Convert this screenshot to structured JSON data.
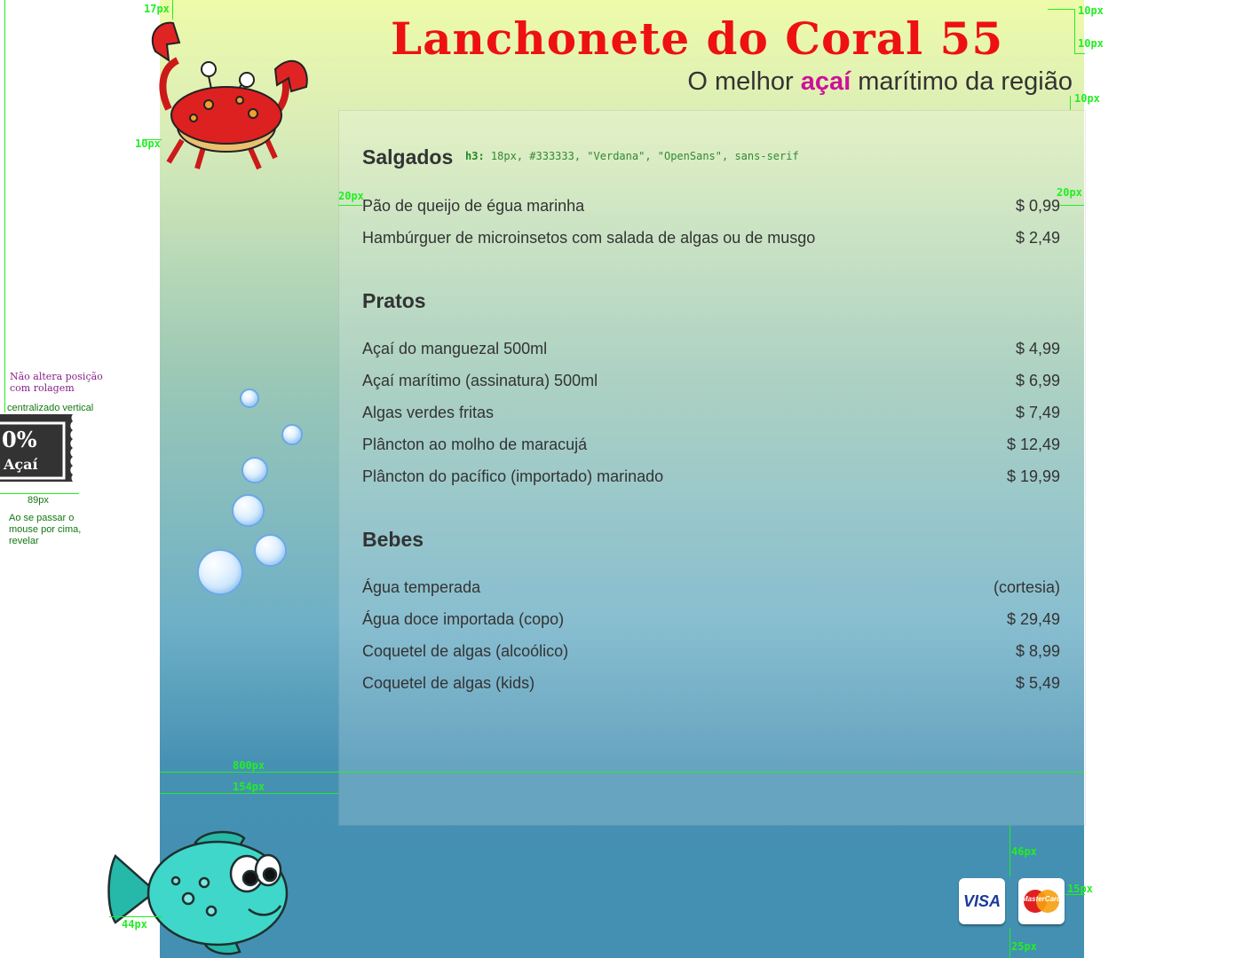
{
  "header": {
    "title": "Lanchonete do Coral 55",
    "subtitle_pre": "O melhor ",
    "subtitle_accent": "açaí",
    "subtitle_post": " marítimo da região"
  },
  "annotations": {
    "m_17": "17px",
    "m_10_a": "10px",
    "m_10_b": "10px",
    "m_10_c": "10px",
    "m_10_d": "10px",
    "m_20_a": "20px",
    "m_20_b": "20px",
    "m_800": "800px",
    "m_154": "154px",
    "m_89": "89px",
    "m_46": "46px",
    "m_15": "15px",
    "m_25": "25px",
    "m_44": "44px",
    "h3_tag": "h3:",
    "h3_spec": "18px, #333333, \"Verdana\", \"OpenSans\", sans-serif",
    "fixed_note": "Não altera posição com rolagem",
    "centered_note": "centralizado vertical",
    "hover_note": "Ao se passar o mouse por cima, revelar"
  },
  "coupon": {
    "percent": "0%",
    "label": "Açaí"
  },
  "menu": {
    "salgados": {
      "title": "Salgados",
      "items": [
        {
          "name": "Pão de queijo de égua marinha",
          "price": "$ 0,99"
        },
        {
          "name": "Hambúrguer de microinsetos com salada de algas ou de musgo",
          "price": "$ 2,49"
        }
      ]
    },
    "pratos": {
      "title": "Pratos",
      "items": [
        {
          "name": "Açaí do manguezal 500ml",
          "price": "$ 4,99"
        },
        {
          "name": "Açaí marítimo (assinatura) 500ml",
          "price": "$ 6,99"
        },
        {
          "name": "Algas verdes fritas",
          "price": "$ 7,49"
        },
        {
          "name": "Plâncton ao molho de maracujá",
          "price": "$ 12,49"
        },
        {
          "name": "Plâncton do pacífico (importado) marinado",
          "price": "$ 19,99"
        }
      ]
    },
    "bebes": {
      "title": "Bebes",
      "items": [
        {
          "name": "Água temperada",
          "price": "(cortesia)"
        },
        {
          "name": "Água doce importada (copo)",
          "price": "$ 29,49"
        },
        {
          "name": "Coquetel de algas (alcoólico)",
          "price": "$ 8,99"
        },
        {
          "name": "Coquetel de algas (kids)",
          "price": "$ 5,49"
        }
      ]
    }
  },
  "payment": {
    "visa": "VISA",
    "mastercard": "MasterCard"
  },
  "colors": {
    "title": "#ee1111",
    "accent": "#cc1199",
    "text": "#333333",
    "measure": "#22ee22"
  },
  "icons": [
    "crab-icon",
    "fish-icon",
    "bubble-icon",
    "coupon-icon",
    "visa-icon",
    "mastercard-icon"
  ]
}
